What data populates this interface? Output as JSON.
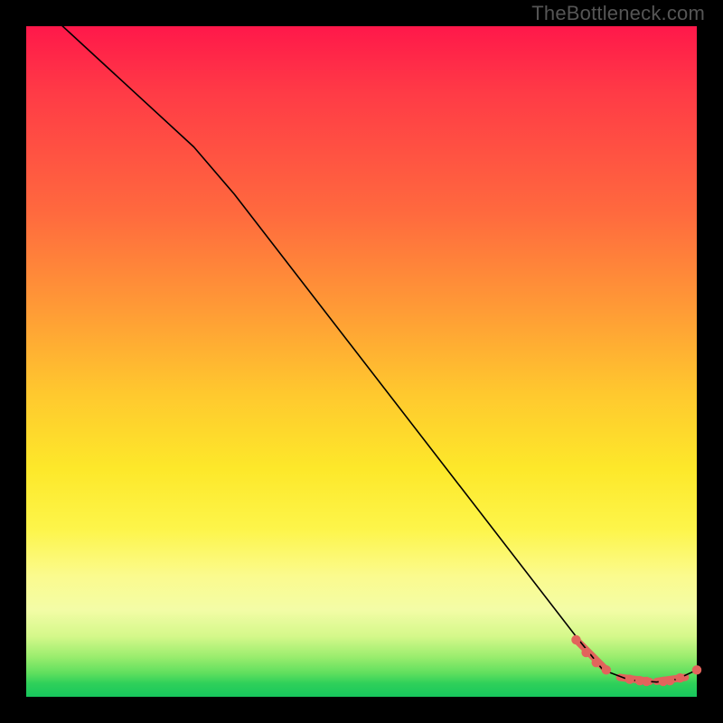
{
  "watermark": "TheBottleneck.com",
  "colors": {
    "marker": "#e2645c",
    "curve": "#000000"
  },
  "chart_data": {
    "type": "line",
    "title": "",
    "xlabel": "",
    "ylabel": "",
    "xlim": [
      0,
      100
    ],
    "ylim": [
      0,
      100
    ],
    "grid": false,
    "curve_points": [
      {
        "x": 0,
        "y": 105
      },
      {
        "x": 25,
        "y": 82
      },
      {
        "x": 31,
        "y": 75
      },
      {
        "x": 82,
        "y": 9
      },
      {
        "x": 86,
        "y": 4
      },
      {
        "x": 90,
        "y": 2.5
      },
      {
        "x": 94,
        "y": 2.2
      },
      {
        "x": 97,
        "y": 2.6
      },
      {
        "x": 100,
        "y": 4
      }
    ],
    "marker_points": [
      {
        "x": 82,
        "y": 8.5
      },
      {
        "x": 83.5,
        "y": 6.6
      },
      {
        "x": 85,
        "y": 5.1
      },
      {
        "x": 86.5,
        "y": 4.0
      },
      {
        "x": 90,
        "y": 2.6
      },
      {
        "x": 91.5,
        "y": 2.4
      },
      {
        "x": 92.5,
        "y": 2.3
      },
      {
        "x": 95,
        "y": 2.3
      },
      {
        "x": 96,
        "y": 2.4
      },
      {
        "x": 97.5,
        "y": 2.8
      },
      {
        "x": 100,
        "y": 4.0
      }
    ],
    "thick_segments": [
      {
        "x1": 82,
        "y1": 8.5,
        "x2": 86.5,
        "y2": 4.0
      },
      {
        "x1": 88.5,
        "y1": 2.9,
        "x2": 93.0,
        "y2": 2.3
      },
      {
        "x1": 94.0,
        "y1": 2.3,
        "x2": 98.3,
        "y2": 2.9
      }
    ]
  }
}
